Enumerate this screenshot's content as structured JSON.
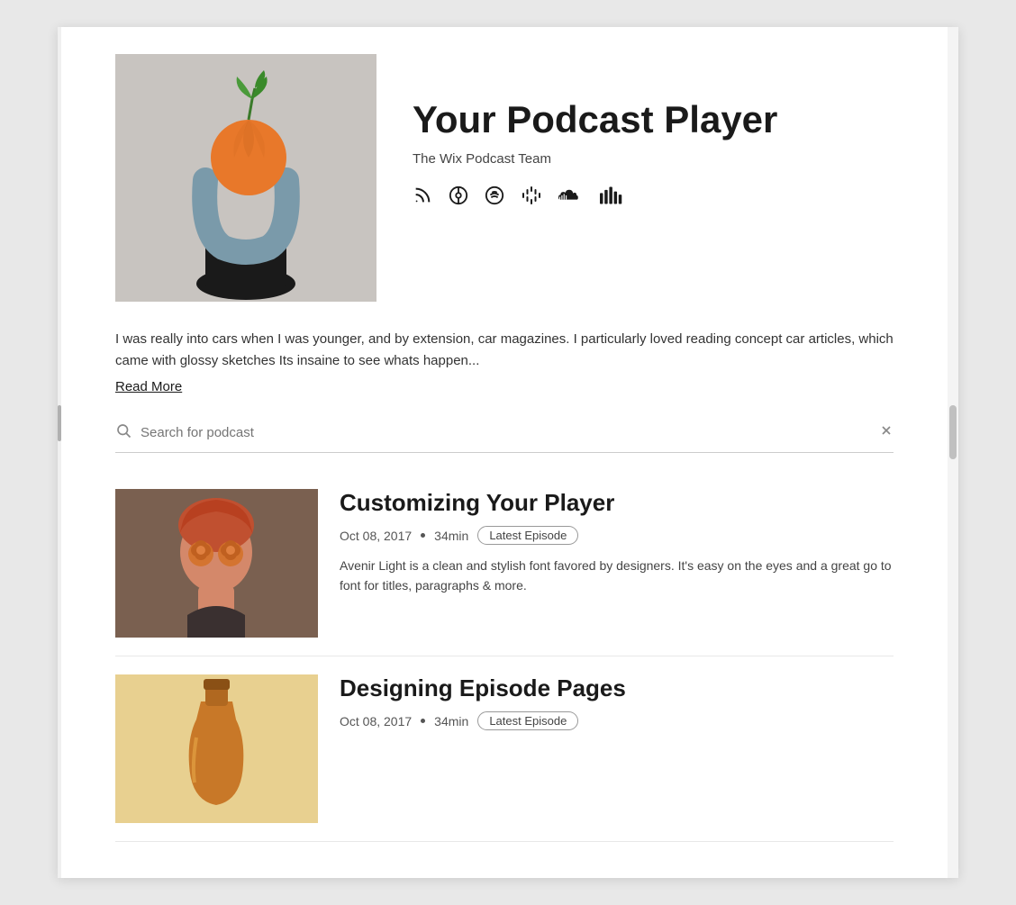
{
  "hero": {
    "title": "Your Podcast Player",
    "author": "The Wix Podcast Team",
    "description": "I was really into cars when I was younger, and by extension, car magazines. I particularly loved reading concept car articles, which came with glossy sketches Its insaine to see whats happen...",
    "read_more_label": "Read More"
  },
  "icons": {
    "rss": "RSS",
    "apple": "Apple",
    "spotify": "Spotify",
    "google": "Google",
    "soundcloud": "SoundCloud",
    "charts": "Charts"
  },
  "search": {
    "placeholder": "Search for podcast"
  },
  "episodes": [
    {
      "title": "Customizing Your Player",
      "date": "Oct 08, 2017",
      "duration": "34min",
      "badge": "Latest Episode",
      "description": "Avenir Light is a clean and stylish font favored by designers. It's easy on the eyes and a great go to font for titles, paragraphs & more."
    },
    {
      "title": "Designing Episode Pages",
      "date": "Oct 08, 2017",
      "duration": "34min",
      "badge": "Latest Episode",
      "description": ""
    }
  ]
}
